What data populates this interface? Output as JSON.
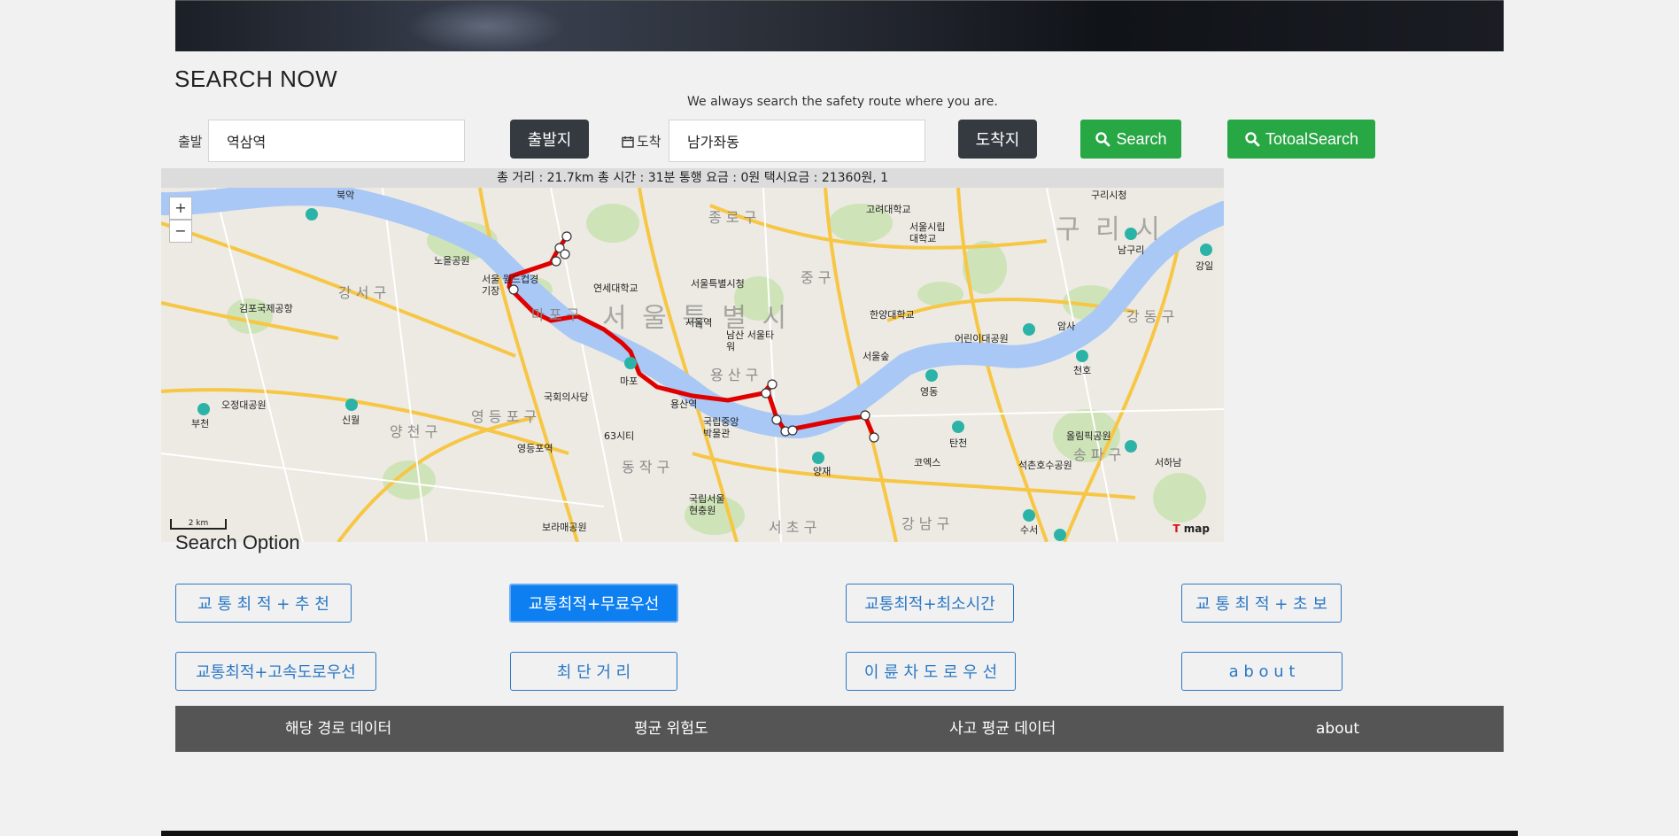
{
  "header": {
    "title": "SEARCH NOW",
    "subtitle": "We always search the safety route where you are."
  },
  "search": {
    "origin_label": "출발",
    "origin_value": "역삼역",
    "origin_button": "출발지",
    "dest_label": "도착",
    "dest_value": "남가좌동",
    "dest_button": "도착지",
    "search_button": "Search",
    "total_search_button": "TotoalSearch"
  },
  "summary": "총 거리 : 21.7km 총 시간 : 31분 통행 요금 : 0원 택시요금 : 21360원, 1",
  "map": {
    "zoom_in": "+",
    "zoom_out": "−",
    "scale": "2 km",
    "logo": "map",
    "labels": {
      "city": "서 울 특 별 시",
      "guri": "구 리 시",
      "gangseo": "강 서 구",
      "mapo": "마 포 구",
      "yongsan": "용 산 구",
      "yeongdeungpo": "영 등 포 구",
      "yangcheon": "양 천 구",
      "dongjak": "동 작 구",
      "seocho": "서 초 구",
      "gangnam": "강 남 구",
      "songpa": "송 파 구",
      "gangdong": "강 동 구",
      "jongno": "종 로 구",
      "junggu": "중 구",
      "seoul_station": "서울역",
      "yongsan_station": "용산역",
      "gimpo": "김포국제공항",
      "assembly": "국회의사당",
      "building63": "63시티",
      "namsan": "남산 서울타워",
      "cityhall": "서울특별시청",
      "yonsei": "연세대학교",
      "hanyang": "한양대학교",
      "seoulforest": "서울숲",
      "children": "어린이대공원",
      "olympic": "올림픽공원",
      "mapo_label": "마포",
      "yeongdong": "영동",
      "coex": "코엑스",
      "yeouido": "영등포역",
      "museum": "국립중앙박물관",
      "worldcup": "서울 월드컵경기장",
      "noeul": "노을공원",
      "bukhan": "북악",
      "gurisi": "구리시청",
      "seoulnat": "서울시립대학교",
      "korea": "고려대학교",
      "yangjae": "양재",
      "cemetery": "국립서울 현충원",
      "bora": "보라매공원",
      "seokchon": "석촌호수공원",
      "cheonho": "천호",
      "amsa": "암사",
      "gangil": "강일",
      "namguri": "남구리",
      "bucheon": "부천",
      "sinwol": "신월",
      "ojeong": "오정대공원",
      "seohanam": "서하남",
      "tancheon": "탄천",
      "suseo": "수서"
    }
  },
  "options": {
    "heading": "Search Option",
    "buttons": [
      "교 통 최 적 + 추 천",
      "교통최적+무료우선",
      "교통최적+최소시간",
      "교 통 최 적 + 초 보",
      "교통최적+고속도로우선",
      "최   단   거   리",
      "이 륜 차 도 로 우 선",
      "a   b   o   u   t"
    ]
  },
  "footer": {
    "links": [
      "해당 경로 데이터",
      "평균 위험도",
      "사고 평균 데이터",
      "about"
    ]
  },
  "colors": {
    "route": "#e00000",
    "river": "#a9c8f5",
    "green_button": "#28a745",
    "dark_button": "#343a40",
    "option_blue": "#2b78c6",
    "active_blue": "#0d7ff0"
  }
}
